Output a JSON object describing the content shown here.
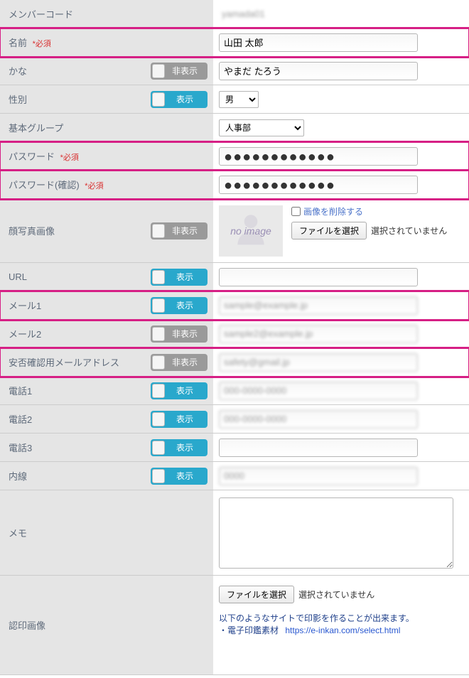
{
  "rows": {
    "member_code": {
      "label": "メンバーコード",
      "value": ""
    },
    "name": {
      "label": "名前",
      "required": "*必須",
      "value": "山田 太郎"
    },
    "kana": {
      "label": "かな",
      "toggle": "非表示",
      "value": "やまだ たろう"
    },
    "gender": {
      "label": "性別",
      "toggle": "表示",
      "value": "男"
    },
    "base_group": {
      "label": "基本グループ",
      "value": "人事部"
    },
    "password": {
      "label": "パスワード",
      "required": "*必須",
      "value": "●●●●●●●●●●●●"
    },
    "password_confirm": {
      "label": "パスワード(確認)",
      "required": "*必須",
      "value": "●●●●●●●●●●●●"
    },
    "photo": {
      "label": "顔写真画像",
      "toggle": "非表示",
      "noimage": "no image",
      "delete_label": "画像を削除する",
      "file_btn": "ファイルを選択",
      "file_status": "選択されていません"
    },
    "url": {
      "label": "URL",
      "toggle": "表示",
      "value": ""
    },
    "mail1": {
      "label": "メール1",
      "toggle": "表示",
      "value": ""
    },
    "mail2": {
      "label": "メール2",
      "toggle": "非表示",
      "value": ""
    },
    "safety_mail": {
      "label": "安否確認用メールアドレス",
      "toggle": "非表示",
      "value": ""
    },
    "tel1": {
      "label": "電話1",
      "toggle": "表示",
      "value": ""
    },
    "tel2": {
      "label": "電話2",
      "toggle": "表示",
      "value": ""
    },
    "tel3": {
      "label": "電話3",
      "toggle": "表示",
      "value": ""
    },
    "extension": {
      "label": "内線",
      "toggle": "表示",
      "value": ""
    },
    "memo": {
      "label": "メモ",
      "value": ""
    },
    "stamp": {
      "label": "認印画像",
      "file_btn": "ファイルを選択",
      "file_status": "選択されていません",
      "note_line": "以下のようなサイトで印影を作ることが出来ます。",
      "note_bullet": "・電子印鑑素材",
      "note_url": "https://e-inkan.com/select.html"
    }
  },
  "toggle_labels": {
    "on": "表示",
    "off": "非表示"
  }
}
